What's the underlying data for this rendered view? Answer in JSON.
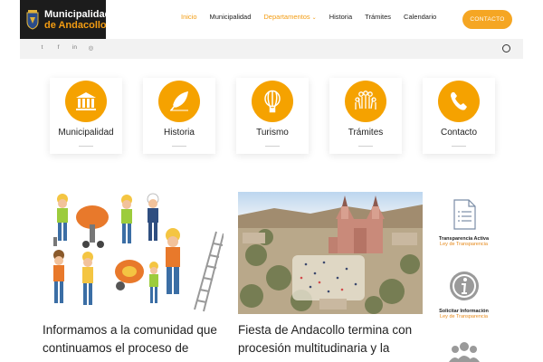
{
  "site": {
    "logo_line1": "Municipalidad",
    "logo_line2": "de Andacollo"
  },
  "nav": {
    "items": [
      "Inicio",
      "Municipalidad",
      "Departamentos",
      "Historia",
      "Trámites",
      "Calendario"
    ],
    "active": "Inicio",
    "cta_label": "CONTACTO"
  },
  "social": {
    "twitter": "t",
    "facebook": "f",
    "linkedin": "in",
    "instagram": "◎"
  },
  "cards": [
    {
      "label": "Municipalidad",
      "icon": "building-icon"
    },
    {
      "label": "Historia",
      "icon": "quill-icon"
    },
    {
      "label": "Turismo",
      "icon": "balloon-icon"
    },
    {
      "label": "Trámites",
      "icon": "people-icon"
    },
    {
      "label": "Contacto",
      "icon": "phone-icon"
    }
  ],
  "posts": [
    {
      "title": "Informamos a la comunidad que continuamos el proceso de"
    },
    {
      "title": "Fiesta de Andacollo termina con procesión multitudinaria y la"
    }
  ],
  "sidebar": [
    {
      "title": "Transparencia Activa",
      "subtitle": "Ley de Transparencia",
      "icon": "document-icon"
    },
    {
      "title": "Solicitar Información",
      "subtitle": "Ley de Transparencia",
      "icon": "info-icon"
    },
    {
      "title": "",
      "subtitle": "",
      "icon": "group-icon"
    }
  ],
  "colors": {
    "accent": "#f5a200",
    "cta": "#f5a623",
    "dark": "#1c1c1c"
  }
}
